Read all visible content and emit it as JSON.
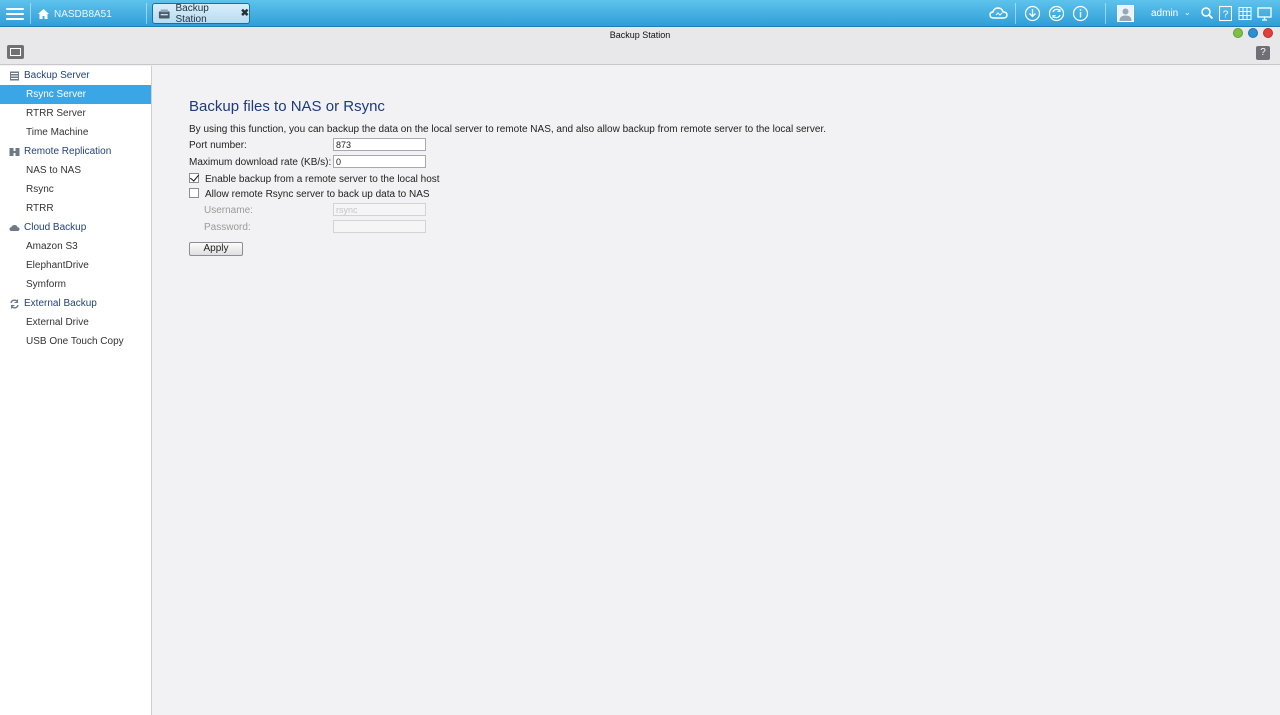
{
  "taskbar": {
    "home_label": "NASDB8A51",
    "app_tab_label": "Backup Station",
    "app_tab_close": "✖",
    "user_name": "admin",
    "user_caret": "⌄",
    "icons": [
      "cloud-icon",
      "download-icon",
      "sync-icon",
      "info-icon",
      "user-avatar-icon",
      "search-icon",
      "help-icon",
      "grid-icon",
      "monitor-icon"
    ]
  },
  "window": {
    "title": "Backup Station",
    "help_label": "?",
    "buttons": {
      "minimize_color": "#7dc142",
      "maximize_color": "#2b8fd6",
      "close_color": "#e0403a"
    }
  },
  "sidebar": {
    "groups": [
      {
        "label": "Backup Server",
        "icon": "server-icon",
        "items": [
          "Rsync Server",
          "RTRR Server",
          "Time Machine"
        ]
      },
      {
        "label": "Remote Replication",
        "icon": "replication-icon",
        "items": [
          "NAS to NAS",
          "Rsync",
          "RTRR"
        ]
      },
      {
        "label": "Cloud Backup",
        "icon": "cloud-backup-icon",
        "items": [
          "Amazon S3",
          "ElephantDrive",
          "Symform"
        ]
      },
      {
        "label": "External Backup",
        "icon": "external-backup-icon",
        "items": [
          "External Drive",
          "USB One Touch Copy"
        ]
      }
    ],
    "active_item": "Rsync Server"
  },
  "main": {
    "title": "Backup files to NAS or Rsync",
    "description": "By using this function, you can backup the data on the local server to remote NAS, and also allow backup from remote server to the local server.",
    "port_label": "Port number:",
    "port_value": "873",
    "rate_label": "Maximum download rate (KB/s):",
    "rate_value": "0",
    "enable_backup_label": "Enable backup from a remote server to the local host",
    "enable_backup_checked": true,
    "allow_rsync_label": "Allow remote Rsync server to back up data to NAS",
    "allow_rsync_checked": false,
    "username_label": "Username:",
    "username_value": "rsync",
    "password_label": "Password:",
    "password_value": "",
    "apply_label": "Apply"
  },
  "colors": {
    "accent": "#3aa6e5",
    "title": "#1d3a7a",
    "group": "#24427a",
    "taskbar": "#2f9ed8"
  }
}
